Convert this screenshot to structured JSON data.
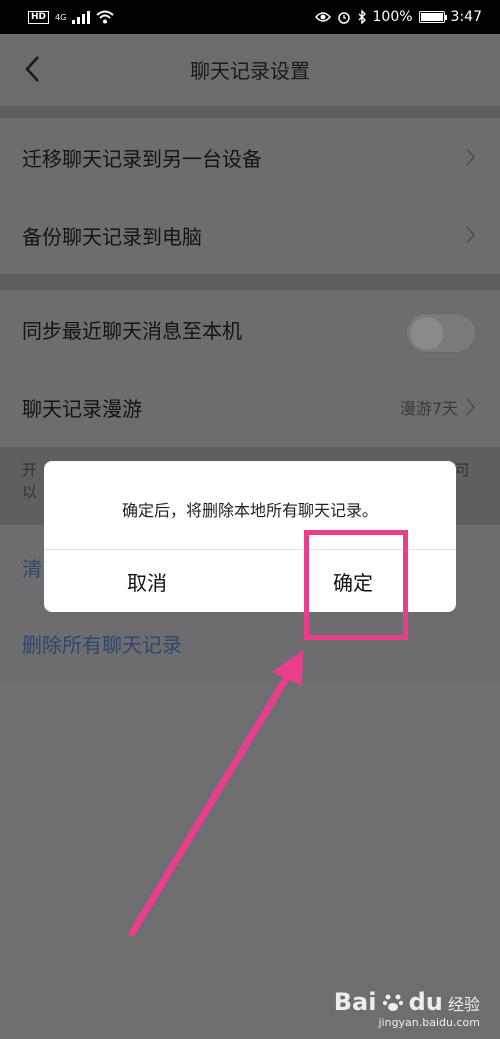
{
  "status_bar": {
    "network_badge": "HD",
    "network_type": "4G",
    "battery": "100%",
    "battery_level": 1.0,
    "time": "3:47",
    "icons": [
      "hd-icon",
      "signal-icon",
      "wifi-icon",
      "eye-icon",
      "alarm-icon",
      "bluetooth-icon",
      "battery-icon"
    ]
  },
  "nav": {
    "title": "聊天记录设置",
    "back_icon": "chevron-left-icon"
  },
  "section1": {
    "items": [
      {
        "label": "迁移聊天记录到另一台设备"
      },
      {
        "label": "备份聊天记录到电脑"
      }
    ]
  },
  "section2": {
    "sync_label": "同步最近聊天消息至本机",
    "sync_enabled": false,
    "roam_label": "聊天记录漫游",
    "roam_value": "漫游7天"
  },
  "hint": {
    "line1_start": "开",
    "line1_end": "可",
    "line2_start": "以"
  },
  "actions": {
    "clear_partial": "清",
    "delete_all": "删除所有聊天记录"
  },
  "dialog": {
    "message": "确定后，将删除本地所有聊天记录。",
    "cancel": "取消",
    "confirm": "确定"
  },
  "annotation": {
    "highlight_color": "#e83e8c"
  },
  "watermark": {
    "logo": "Bai",
    "logo_end": "du",
    "text": "经验",
    "url": "jingyan.baidu.com"
  }
}
